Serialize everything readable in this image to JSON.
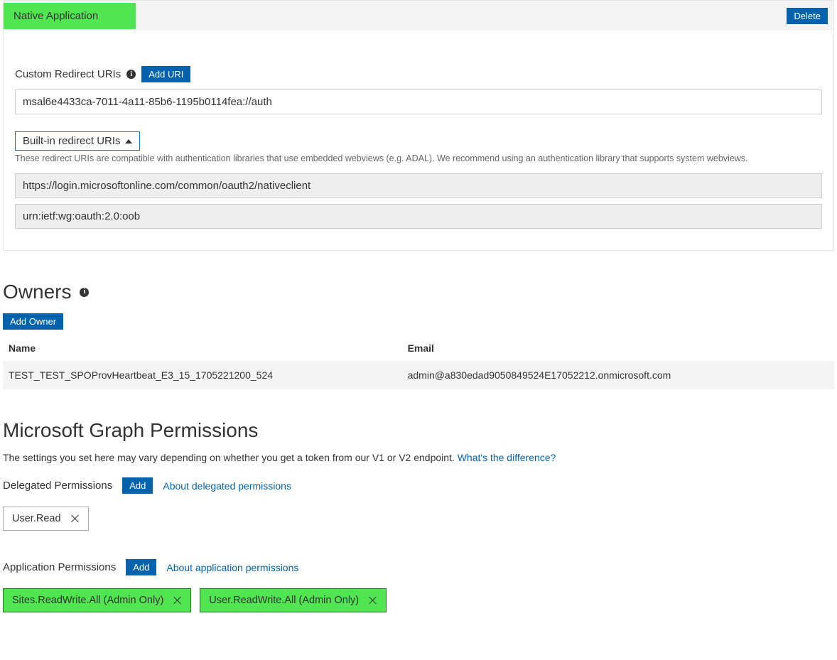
{
  "nativeApp": {
    "title": "Native Application",
    "deleteBtn": "Delete",
    "customRedirectLabel": "Custom Redirect URIs",
    "addUriBtn": "Add URI",
    "customRedirectValue": "msal6e4433ca-7011-4a11-85b6-1195b0114fea://auth",
    "builtinToggle": "Built-in redirect URIs",
    "builtinHelper": "These redirect URIs are compatible with authentication libraries that use embedded webviews (e.g. ADAL). We recommend using an authentication library that supports system webviews.",
    "builtinUri1": "https://login.microsoftonline.com/common/oauth2/nativeclient",
    "builtinUri2": "urn:ietf:wg:oauth:2.0:oob"
  },
  "owners": {
    "heading": "Owners",
    "addBtn": "Add Owner",
    "colName": "Name",
    "colEmail": "Email",
    "row": {
      "name": "TEST_TEST_SPOProvHeartbeat_E3_15_1705221200_524",
      "email": "admin@a830edad9050849524E17052212.onmicrosoft.com"
    }
  },
  "graph": {
    "heading": "Microsoft Graph Permissions",
    "subtext": "The settings you set here may vary depending on whether you get a token from our V1 or V2 endpoint. ",
    "difflink": "What's the difference?",
    "delegated": {
      "label": "Delegated Permissions",
      "addBtn": "Add",
      "aboutLink": "About delegated permissions",
      "tag1": "User.Read"
    },
    "application": {
      "label": "Application Permissions",
      "addBtn": "Add",
      "aboutLink": "About application permissions",
      "tag1": "Sites.ReadWrite.All (Admin Only)",
      "tag2": "User.ReadWrite.All (Admin Only)"
    }
  }
}
